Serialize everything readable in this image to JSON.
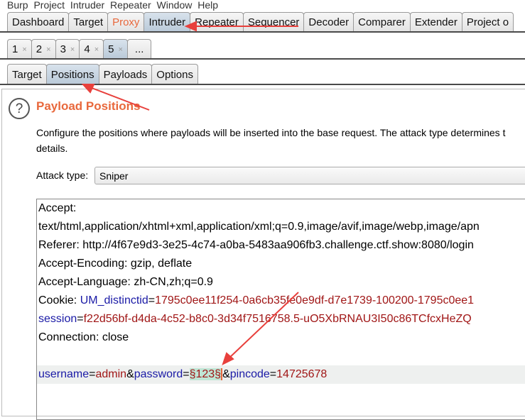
{
  "menu": "Burp  Project  Intruder  Repeater  Window  Help",
  "main_tabs": [
    "Dashboard",
    "Target",
    "Proxy",
    "Intruder",
    "Repeater",
    "Sequencer",
    "Decoder",
    "Comparer",
    "Extender",
    "Project o"
  ],
  "attack_tabs": [
    "1",
    "2",
    "3",
    "4",
    "5",
    "..."
  ],
  "sub_tabs": [
    "Target",
    "Positions",
    "Payloads",
    "Options"
  ],
  "title": "Payload Positions",
  "description": [
    "Configure the positions where payloads will be inserted into the base request. The attack type determines t",
    "details."
  ],
  "attack_type_label": "Attack type:",
  "attack_type_value": "Sniper",
  "request": {
    "l1": "Accept:",
    "l2": "text/html,application/xhtml+xml,application/xml;q=0.9,image/avif,image/webp,image/apn",
    "l3": "Referer: http://4f67e9d3-3e25-4c74-a0ba-5483aa906fb3.challenge.ctf.show:8080/login",
    "l4": "Accept-Encoding: gzip, deflate",
    "l5": "Accept-Language: zh-CN,zh;q=0.9",
    "cookie_label": "Cookie: ",
    "c1k": "UM_distinctid",
    "c1v": "1795c0ee11f254-0a6cb35fe0e9df-d7e1739-100200-1795c0ee1",
    "c2k": "session",
    "c2v": "f22d56bf-d4da-4c52-b8c0-3d34f7516758.5-uO5XbRNAU3I50c86TCfcxHeZQ",
    "l8": "Connection: close",
    "b_user_k": "username",
    "b_user_v": "admin",
    "b_pass_k": "password",
    "b_pass_v": "§123§",
    "b_pin_k": "pincode",
    "b_pin_v": "14725678",
    "eq": "=",
    "amp": "&"
  },
  "colors": {
    "accent": "#e8683c",
    "key": "#1a1aa6",
    "value": "#a01616",
    "annotation": "#e8403c"
  }
}
